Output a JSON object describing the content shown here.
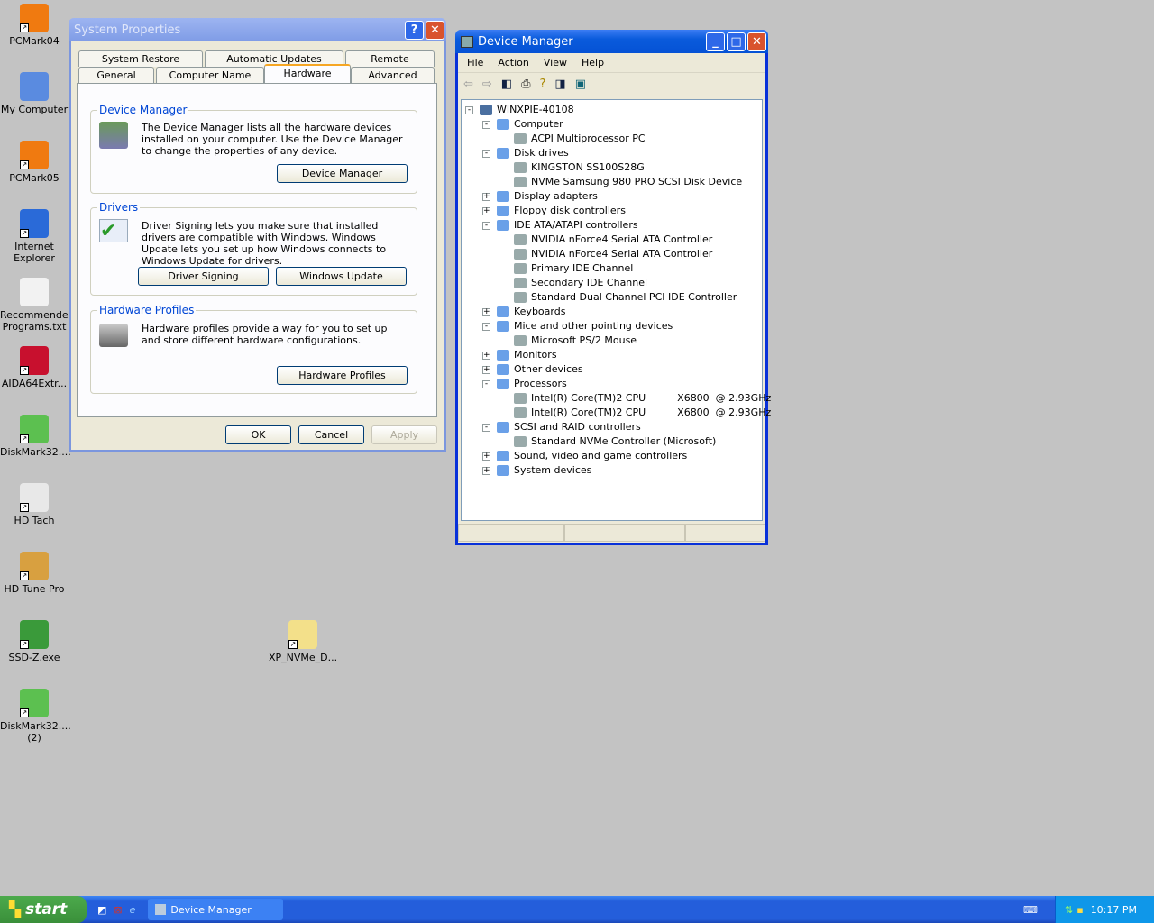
{
  "desktop": {
    "icons": [
      {
        "label": "PCMark04",
        "color": "#f07a10"
      },
      {
        "label": "My Computer",
        "color": "#5a8be0"
      },
      {
        "label": "PCMark05",
        "color": "#f07a10"
      },
      {
        "label": "Internet Explorer",
        "color": "#2a6ad8"
      },
      {
        "label": "Recommended Programs.txt",
        "color": "#f2f2f2"
      },
      {
        "label": "AIDA64Extr...",
        "color": "#c8102e"
      },
      {
        "label": "DiskMark32....",
        "color": "#5cc050"
      },
      {
        "label": "HD Tach",
        "color": "#e8e8e8"
      },
      {
        "label": "HD Tune Pro",
        "color": "#d8a040"
      },
      {
        "label": "SSD-Z.exe",
        "color": "#3a9a3a"
      },
      {
        "label": "DiskMark32.... (2)",
        "color": "#5cc050"
      },
      {
        "label": "XP_NVMe_D...",
        "color": "#f3e08a"
      }
    ]
  },
  "sysprops": {
    "title": "System Properties",
    "tabs_row1": [
      "System Restore",
      "Automatic Updates",
      "Remote"
    ],
    "tabs_row2": [
      "General",
      "Computer Name",
      "Hardware",
      "Advanced"
    ],
    "dm_group": "Device Manager",
    "dm_text": "The Device Manager lists all the hardware devices installed on your computer. Use the Device Manager to change the properties of any device.",
    "dm_button": "Device Manager",
    "drv_group": "Drivers",
    "drv_text": "Driver Signing lets you make sure that installed drivers are compatible with Windows. Windows Update lets you set up how Windows connects to Windows Update for drivers.",
    "drv_sign": "Driver Signing",
    "drv_update": "Windows Update",
    "hp_group": "Hardware Profiles",
    "hp_text": "Hardware profiles provide a way for you to set up and store different hardware configurations.",
    "hp_button": "Hardware Profiles",
    "ok": "OK",
    "cancel": "Cancel",
    "apply": "Apply"
  },
  "devmgr": {
    "title": "Device Manager",
    "menu": [
      "File",
      "Action",
      "View",
      "Help"
    ],
    "tree": [
      {
        "level": 0,
        "label": "WINXPIE-40108",
        "exp": "-"
      },
      {
        "level": 1,
        "label": "Computer",
        "exp": "-"
      },
      {
        "level": 2,
        "label": "ACPI Multiprocessor PC"
      },
      {
        "level": 1,
        "label": "Disk drives",
        "exp": "-"
      },
      {
        "level": 2,
        "label": "KINGSTON SS100S28G"
      },
      {
        "level": 2,
        "label": "NVMe Samsung 980 PRO SCSI Disk Device"
      },
      {
        "level": 1,
        "label": "Display adapters",
        "exp": "+"
      },
      {
        "level": 1,
        "label": "Floppy disk controllers",
        "exp": "+"
      },
      {
        "level": 1,
        "label": "IDE ATA/ATAPI controllers",
        "exp": "-"
      },
      {
        "level": 2,
        "label": "NVIDIA nForce4 Serial ATA Controller"
      },
      {
        "level": 2,
        "label": "NVIDIA nForce4 Serial ATA Controller"
      },
      {
        "level": 2,
        "label": "Primary IDE Channel"
      },
      {
        "level": 2,
        "label": "Secondary IDE Channel"
      },
      {
        "level": 2,
        "label": "Standard Dual Channel PCI IDE Controller"
      },
      {
        "level": 1,
        "label": "Keyboards",
        "exp": "+"
      },
      {
        "level": 1,
        "label": "Mice and other pointing devices",
        "exp": "-"
      },
      {
        "level": 2,
        "label": "Microsoft PS/2 Mouse"
      },
      {
        "level": 1,
        "label": "Monitors",
        "exp": "+"
      },
      {
        "level": 1,
        "label": "Other devices",
        "exp": "+"
      },
      {
        "level": 1,
        "label": "Processors",
        "exp": "-"
      },
      {
        "level": 2,
        "label": "Intel(R) Core(TM)2 CPU          X6800  @ 2.93GHz"
      },
      {
        "level": 2,
        "label": "Intel(R) Core(TM)2 CPU          X6800  @ 2.93GHz"
      },
      {
        "level": 1,
        "label": "SCSI and RAID controllers",
        "exp": "-"
      },
      {
        "level": 2,
        "label": "Standard NVMe Controller (Microsoft)"
      },
      {
        "level": 1,
        "label": "Sound, video and game controllers",
        "exp": "+"
      },
      {
        "level": 1,
        "label": "System devices",
        "exp": "+"
      }
    ]
  },
  "taskbar": {
    "start": "start",
    "task": "Device Manager",
    "clock": "10:17 PM"
  }
}
